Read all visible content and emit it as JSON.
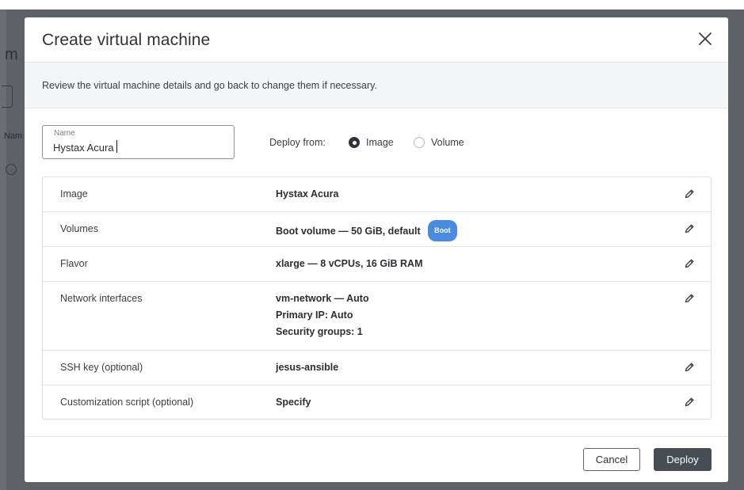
{
  "background": {
    "fragment_title": "m",
    "fragment_label": "Nam"
  },
  "modal": {
    "title": "Create virtual machine",
    "subheader": "Review the virtual machine details and go back to change them if necessary.",
    "name_field": {
      "label": "Name",
      "value": "Hystax Acura"
    },
    "deploy_from": {
      "label": "Deploy from:",
      "options": [
        {
          "label": "Image",
          "checked": true
        },
        {
          "label": "Volume",
          "checked": false
        }
      ]
    },
    "details": [
      {
        "label": "Image",
        "value": "Hystax Acura"
      },
      {
        "label": "Volumes",
        "value": "Boot volume  — 50 GiB, default",
        "badge": "Boot"
      },
      {
        "label": "Flavor",
        "value": "xlarge  — 8 vCPUs, 16 GiB RAM"
      },
      {
        "label": "Network interfaces",
        "lines": [
          "vm-network  — Auto",
          "Primary IP:  Auto",
          "Security groups:  1"
        ]
      },
      {
        "label": "SSH key (optional)",
        "value": "jesus-ansible"
      },
      {
        "label": "Customization script (optional)",
        "value": "Specify"
      }
    ],
    "footer": {
      "cancel_label": "Cancel",
      "deploy_label": "Deploy"
    }
  },
  "icons": {
    "close": "close-icon",
    "edit": "pencil-icon"
  },
  "colors": {
    "backdrop": "#5e6266",
    "badge": "#4a8bdf",
    "primary_button": "#474d53"
  }
}
